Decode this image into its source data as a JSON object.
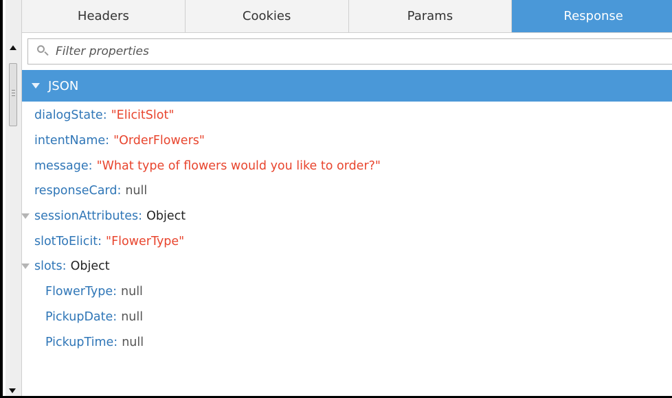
{
  "tabs": [
    {
      "label": "Headers",
      "active": false
    },
    {
      "label": "Cookies",
      "active": false
    },
    {
      "label": "Params",
      "active": false
    },
    {
      "label": "Response",
      "active": true
    }
  ],
  "filter": {
    "placeholder": "Filter properties",
    "value": ""
  },
  "json_section": {
    "label": "JSON",
    "expanded": true
  },
  "tree": {
    "dialogState": {
      "key": "dialogState",
      "value": "\"ElicitSlot\""
    },
    "intentName": {
      "key": "intentName",
      "value": "\"OrderFlowers\""
    },
    "message": {
      "key": "message",
      "value": "\"What type of flowers would you like to order?\""
    },
    "responseCard": {
      "key": "responseCard",
      "value": "null"
    },
    "sessionAttributes": {
      "key": "sessionAttributes",
      "value": "Object",
      "expanded": true
    },
    "slotToElicit": {
      "key": "slotToElicit",
      "value": "\"FlowerType\""
    },
    "slots": {
      "key": "slots",
      "value": "Object",
      "expanded": true,
      "children": [
        {
          "key": "FlowerType",
          "value": "null"
        },
        {
          "key": "PickupDate",
          "value": "null"
        },
        {
          "key": "PickupTime",
          "value": "null"
        }
      ]
    }
  },
  "colors": {
    "accent": "#4a98d8",
    "key": "#2f76b7",
    "string": "#e8452e",
    "null": "#555555"
  }
}
